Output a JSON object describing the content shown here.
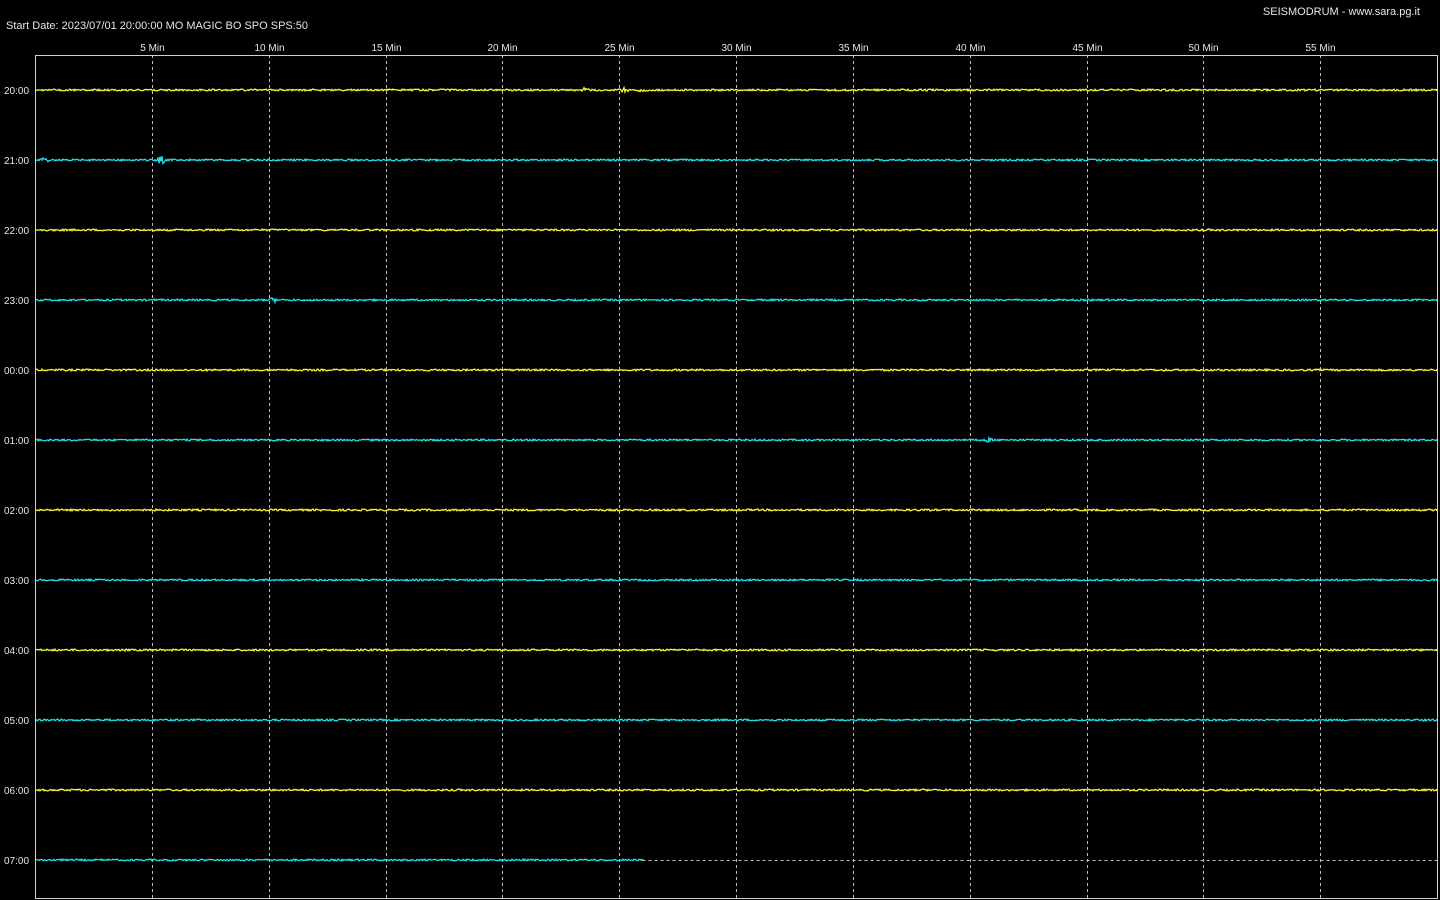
{
  "header": {
    "start_info": "Start Date: 2023/07/01 20:00:00 MO MAGIC BO SPO SPS:50",
    "credit": "SEISMODRUM - www.sara.pg.it"
  },
  "colors": {
    "background": "#000000",
    "frame": "#cfcfcf",
    "grid": "#bdbdbd",
    "text": "#e6e6e6",
    "trace_a": "#f6f63a",
    "trace_b": "#22e0ea"
  },
  "chart_data": {
    "type": "line",
    "title": "",
    "xlabel": "",
    "ylabel": "",
    "x_unit": "min",
    "xlim": [
      0,
      60
    ],
    "x_ticks": [
      {
        "value": 5,
        "label": "5 Min"
      },
      {
        "value": 10,
        "label": "10 Min"
      },
      {
        "value": 15,
        "label": "15 Min"
      },
      {
        "value": 20,
        "label": "20 Min"
      },
      {
        "value": 25,
        "label": "25 Min"
      },
      {
        "value": 30,
        "label": "30 Min"
      },
      {
        "value": 35,
        "label": "35 Min"
      },
      {
        "value": 40,
        "label": "40 Min"
      },
      {
        "value": 45,
        "label": "45 Min"
      },
      {
        "value": 50,
        "label": "50 Min"
      },
      {
        "value": 55,
        "label": "55 Min"
      }
    ],
    "grid": true,
    "series": [
      {
        "name": "20:00",
        "color": "yellow",
        "end_min": 60,
        "events": [
          {
            "at_min": 23.5,
            "amp": 1.5
          },
          {
            "at_min": 25.2,
            "amp": 2.2
          },
          {
            "at_min": 26.0,
            "amp": 1.5
          }
        ]
      },
      {
        "name": "21:00",
        "color": "cyan",
        "end_min": 60,
        "events": [
          {
            "at_min": 0.4,
            "amp": 2.5
          },
          {
            "at_min": 5.4,
            "amp": 4
          }
        ]
      },
      {
        "name": "22:00",
        "color": "yellow",
        "end_min": 60,
        "events": []
      },
      {
        "name": "23:00",
        "color": "cyan",
        "end_min": 60,
        "events": [
          {
            "at_min": 10.2,
            "amp": 2
          }
        ]
      },
      {
        "name": "00:00",
        "color": "yellow",
        "end_min": 60,
        "events": []
      },
      {
        "name": "01:00",
        "color": "cyan",
        "end_min": 60,
        "events": [
          {
            "at_min": 40.8,
            "amp": 1.5
          }
        ]
      },
      {
        "name": "02:00",
        "color": "yellow",
        "end_min": 60,
        "events": []
      },
      {
        "name": "03:00",
        "color": "cyan",
        "end_min": 60,
        "events": []
      },
      {
        "name": "04:00",
        "color": "yellow",
        "end_min": 60,
        "events": []
      },
      {
        "name": "05:00",
        "color": "cyan",
        "end_min": 60,
        "events": []
      },
      {
        "name": "06:00",
        "color": "yellow",
        "end_min": 60,
        "events": []
      },
      {
        "name": "07:00",
        "color": "cyan",
        "end_min": 26,
        "events": []
      }
    ]
  }
}
